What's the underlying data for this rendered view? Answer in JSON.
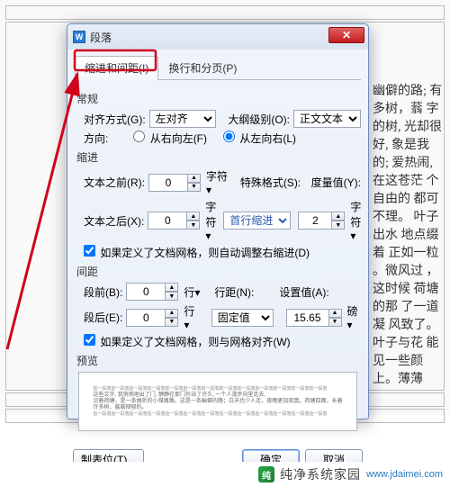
{
  "dialog": {
    "title": "段落",
    "icon_glyph": "W",
    "tabs": {
      "active": "缩进和间距(I)",
      "other": "换行和分页(P)"
    },
    "general": {
      "title": "常规",
      "align_label": "对齐方式(G):",
      "align_value": "左对齐",
      "outline_label": "大纲级别(O):",
      "outline_value": "正文文本",
      "direction_label": "方向:",
      "direction_rtl": "从右向左(F)",
      "direction_ltr": "从左向右(L)"
    },
    "indent": {
      "title": "缩进",
      "before_label": "文本之前(R):",
      "before_value": "0",
      "before_unit": "字符",
      "after_label": "文本之后(X):",
      "after_value": "0",
      "after_unit": "字符",
      "special_label": "特殊格式(S):",
      "special_value": "首行缩进",
      "measure_label": "度量值(Y):",
      "measure_value": "2",
      "measure_unit": "字符",
      "auto_check": "如果定义了文档网格，则自动调整右缩进(D)"
    },
    "spacing": {
      "title": "间距",
      "before_label": "段前(B):",
      "before_value": "0",
      "before_unit": "行",
      "after_label": "段后(E):",
      "after_value": "0",
      "after_unit": "行",
      "linesp_label": "行距(N):",
      "linesp_value": "固定值",
      "setval_label": "设置值(A):",
      "setval_value": "15.65",
      "setval_unit": "磅",
      "grid_check": "如果定义了文档网格，则与网格对齐(W)"
    },
    "preview_title": "预览",
    "preview_lines": [
      "前一段落前一段落前一段落前一段落前一段落前一段落前一段落前一段落前一段落前一段落前一段落前一段落前一段落",
      "这些文字, 我悄悄地出了门, 静静在那门外站了许久, 一个人漫步向里走去,",
      "沿着荷塘，是一条曲折的小煤屑路。这是一条幽僻的路；白天也少人走，夜晚更加寂寞。荷塘四面，长着许多树，蓊蓊郁郁的。",
      "后一段落后一段落后一段落后一段落后一段落后一段落后一段落后一段落后一段落后一段落后一段落后一段落后一段落"
    ],
    "footer": {
      "tabs_btn": "制表位(T)...",
      "ok": "确定",
      "cancel": "取消"
    }
  },
  "page_footer": {
    "site_name": "纯净系统家园",
    "site_url": "www.jdaimei.com"
  },
  "bg_text_right": "幽僻的路;\n有多树，蓊\n字的树,\n光却很好,\n\n象是我的;\n爱热闹,\n在这苍茫\n个自由的\n都可不理。\n\n叶子出水\n地点缀着\n正如一粒\n。微风过\n，这时候\n荷塘的那\n了一道凝\n风致了。\n叶子与花\n能见一些颜\n\n上。薄薄"
}
